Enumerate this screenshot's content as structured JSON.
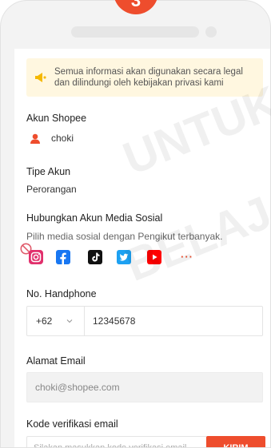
{
  "step_number": "3",
  "notice": {
    "text": "Semua informasi akan digunakan secara legal dan dilindungi oleh kebijakan privasi kami"
  },
  "shopee_account": {
    "label": "Akun Shopee",
    "username": "choki"
  },
  "account_type": {
    "label": "Tipe Akun",
    "value": "Perorangan"
  },
  "social_media": {
    "label": "Hubungkan Akun Media Sosial",
    "hint": "Pilih media sosial dengan Pengikut terbanyak.",
    "platforms": [
      "instagram",
      "facebook",
      "tiktok",
      "twitter",
      "youtube",
      "more"
    ],
    "more_label": "···"
  },
  "phone": {
    "label": "No. Handphone",
    "country_code": "+62",
    "number": "12345678"
  },
  "email": {
    "label": "Alamat Email",
    "value": "choki@shopee.com"
  },
  "verification": {
    "label": "Kode verifikasi email",
    "placeholder": "Silakan masukkan kode verifikasi email",
    "button_label": "KIRIM"
  },
  "watermark": {
    "line1": "UNTUK",
    "line2": "BELAJAR"
  },
  "colors": {
    "accent": "#ee4d2d",
    "notice_bg": "#fff7e0",
    "instagram": "#e1306c",
    "facebook": "#1877f2",
    "tiktok": "#111111",
    "twitter": "#1da1f2",
    "youtube": "#ff0000"
  }
}
